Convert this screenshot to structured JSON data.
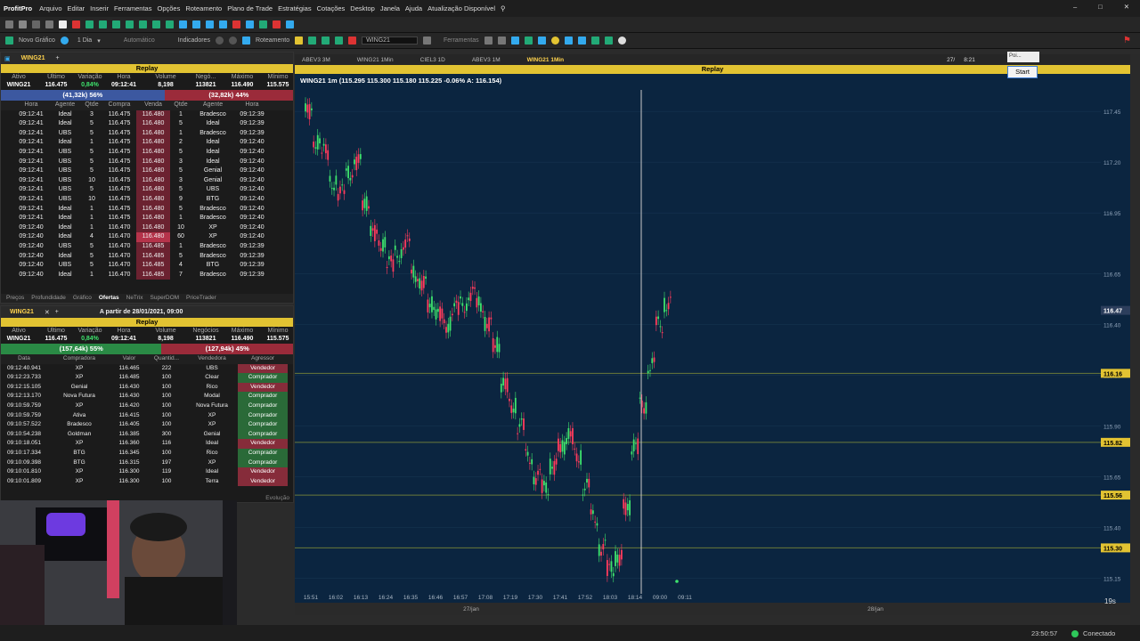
{
  "menu": {
    "brand": "ProfitPro",
    "items": [
      "Arquivo",
      "Editar",
      "Inserir",
      "Ferramentas",
      "Opções",
      "Roteamento",
      "Plano de Trade",
      "Estratégias",
      "Cotações",
      "Desktop",
      "Janela",
      "Ajuda",
      "Atualização Disponível"
    ]
  },
  "toolbar2": {
    "novo_grafico": "Novo Gráfico",
    "periodo": "1 Dia",
    "automatico": "Automático",
    "indicadores": "Indicadores",
    "roteamento": "Roteamento",
    "ativo": "WING21",
    "ferramentas": "Ferramentas"
  },
  "replay_label": "Replay",
  "top_panel": {
    "tab": "WING21",
    "quote_headers": [
      "Ativo",
      "Último",
      "Variação",
      "Hora",
      "Volume",
      "Negó...",
      "Máximo",
      "Mínimo"
    ],
    "quote_values": [
      "WING21",
      "116.475",
      "0,84%",
      "09:12:41",
      "8,198",
      "113821",
      "116.490",
      "115.575"
    ],
    "buy_pct": "(41,32k) 56%",
    "sell_pct": "(32,82k) 44%",
    "table_headers": [
      "Hora",
      "Agente",
      "Qtde",
      "Compra",
      "Venda",
      "Qtde",
      "Agente",
      "Hora"
    ],
    "rows": [
      [
        "09:12:41",
        "Ideal",
        "3",
        "116.475",
        "116.480",
        "1",
        "Bradesco",
        "09:12:39"
      ],
      [
        "09:12:41",
        "Ideal",
        "5",
        "116.475",
        "116.480",
        "5",
        "Ideal",
        "09:12:39"
      ],
      [
        "09:12:41",
        "UBS",
        "5",
        "116.475",
        "116.480",
        "1",
        "Bradesco",
        "09:12:39"
      ],
      [
        "09:12:41",
        "Ideal",
        "1",
        "116.475",
        "116.480",
        "2",
        "Ideal",
        "09:12:40"
      ],
      [
        "09:12:41",
        "UBS",
        "5",
        "116.475",
        "116.480",
        "5",
        "Ideal",
        "09:12:40"
      ],
      [
        "09:12:41",
        "UBS",
        "5",
        "116.475",
        "116.480",
        "3",
        "Ideal",
        "09:12:40"
      ],
      [
        "09:12:41",
        "UBS",
        "5",
        "116.475",
        "116.480",
        "5",
        "Genial",
        "09:12:40"
      ],
      [
        "09:12:41",
        "UBS",
        "10",
        "116.475",
        "116.480",
        "3",
        "Genial",
        "09:12:40"
      ],
      [
        "09:12:41",
        "UBS",
        "5",
        "116.475",
        "116.480",
        "5",
        "UBS",
        "09:12:40"
      ],
      [
        "09:12:41",
        "UBS",
        "10",
        "116.475",
        "116.480",
        "9",
        "BTG",
        "09:12:40"
      ],
      [
        "09:12:41",
        "Ideal",
        "1",
        "116.475",
        "116.480",
        "5",
        "Bradesco",
        "09:12:40"
      ],
      [
        "09:12:41",
        "Ideal",
        "1",
        "116.475",
        "116.480",
        "1",
        "Bradesco",
        "09:12:40"
      ],
      [
        "09:12:40",
        "Ideal",
        "1",
        "116.470",
        "116.480",
        "10",
        "XP",
        "09:12:40"
      ],
      [
        "09:12:40",
        "Ideal",
        "4",
        "116.470",
        "116.480",
        "60",
        "XP",
        "09:12:40"
      ],
      [
        "09:12:40",
        "UBS",
        "5",
        "116.470",
        "116.485",
        "1",
        "Bradesco",
        "09:12:39"
      ],
      [
        "09:12:40",
        "Ideal",
        "5",
        "116.470",
        "116.485",
        "5",
        "Bradesco",
        "09:12:39"
      ],
      [
        "09:12:40",
        "UBS",
        "5",
        "116.470",
        "116.485",
        "4",
        "BTG",
        "09:12:39"
      ],
      [
        "09:12:40",
        "Ideal",
        "1",
        "116.470",
        "116.485",
        "7",
        "Bradesco",
        "09:12:39"
      ]
    ],
    "footer_tabs": [
      "Preços",
      "Profundidade",
      "Gráfico",
      "Ofertas",
      "NeTrix",
      "SuperDOM",
      "PriceTrader"
    ]
  },
  "bottom_panel": {
    "tab": "WING21",
    "range": "A partir de 28/01/2021, 09:00",
    "quote_headers": [
      "Ativo",
      "Último",
      "Variação",
      "Hora",
      "Volume",
      "Negócios",
      "Máximo",
      "Mínimo"
    ],
    "quote_values": [
      "WING21",
      "116.475",
      "0,84%",
      "09:12:41",
      "8,198",
      "113821",
      "116.490",
      "115.575"
    ],
    "buy_pct": "(157,64k) 55%",
    "sell_pct": "(127,94k) 45%",
    "table_headers": [
      "Data",
      "Compradora",
      "Valor",
      "Quantid...",
      "Vendedora",
      "Agressor"
    ],
    "rows": [
      [
        "09:12:40.941",
        "XP",
        "116.465",
        "222",
        "UBS",
        "Vendedor"
      ],
      [
        "09:12:23.733",
        "XP",
        "116.485",
        "100",
        "Clear",
        "Comprador"
      ],
      [
        "09:12:15.105",
        "Genial",
        "116.430",
        "100",
        "Rico",
        "Vendedor"
      ],
      [
        "09:12:13.170",
        "Nova Futura",
        "116.430",
        "100",
        "Modal",
        "Comprador"
      ],
      [
        "09:10:59.759",
        "XP",
        "116.420",
        "100",
        "Nova Futura",
        "Comprador"
      ],
      [
        "09:10:59.759",
        "Ativa",
        "116.415",
        "100",
        "XP",
        "Comprador"
      ],
      [
        "09:10:57.522",
        "Bradesco",
        "116.405",
        "100",
        "XP",
        "Comprador"
      ],
      [
        "09:10:54.238",
        "Goldman",
        "116.385",
        "300",
        "Genial",
        "Comprador"
      ],
      [
        "09:10:18.051",
        "XP",
        "116.360",
        "116",
        "Ideal",
        "Vendedor"
      ],
      [
        "09:10:17.334",
        "BTG",
        "116.345",
        "100",
        "Rico",
        "Comprador"
      ],
      [
        "09:10:09.398",
        "BTG",
        "116.315",
        "197",
        "XP",
        "Comprador"
      ],
      [
        "09:10:01.810",
        "XP",
        "116.300",
        "119",
        "Ideal",
        "Vendedor"
      ],
      [
        "09:10:01.809",
        "XP",
        "116.300",
        "100",
        "Terra",
        "Vendedor"
      ]
    ],
    "evolucao": "Evolução"
  },
  "chart": {
    "tabs": [
      "ABEV3 3M",
      "WING21 1Min",
      "CIEL3 1D",
      "ABEV3 1M",
      "WING21 1Min"
    ],
    "info": "WING21 1m (115.295 115.300 115.180 115.225 -0.06% A: 116.154)",
    "date_partial": "27/",
    "clock_partial": "8:21",
    "start": "Start",
    "popup": "Poi...",
    "bottom_right": "19s"
  },
  "chart_data": {
    "type": "candlestick",
    "x_ticks": [
      "15:51",
      "16:02",
      "16:13",
      "16:24",
      "16:35",
      "16:46",
      "16:57",
      "17:08",
      "17:19",
      "17:30",
      "17:41",
      "17:52",
      "18:03",
      "18:14",
      "09:00",
      "09:11"
    ],
    "date_labels": [
      "27/jan",
      "28/jan"
    ],
    "y_ticks": [
      117.45,
      117.2,
      116.95,
      116.65,
      116.4,
      116.15,
      115.9,
      115.65,
      115.4,
      115.15
    ],
    "price_labels": [
      {
        "value": "116.47",
        "color": "#2c3e5c"
      },
      {
        "value": "116.16",
        "color": "#e2c332"
      },
      {
        "value": "115.82",
        "color": "#e2c332"
      },
      {
        "value": "115.56",
        "color": "#e2c332"
      },
      {
        "value": "115.30",
        "color": "#e2c332"
      }
    ],
    "ylim": [
      115.1,
      117.6
    ]
  },
  "status": {
    "time": "23:50:57",
    "connected": "Conectado"
  }
}
